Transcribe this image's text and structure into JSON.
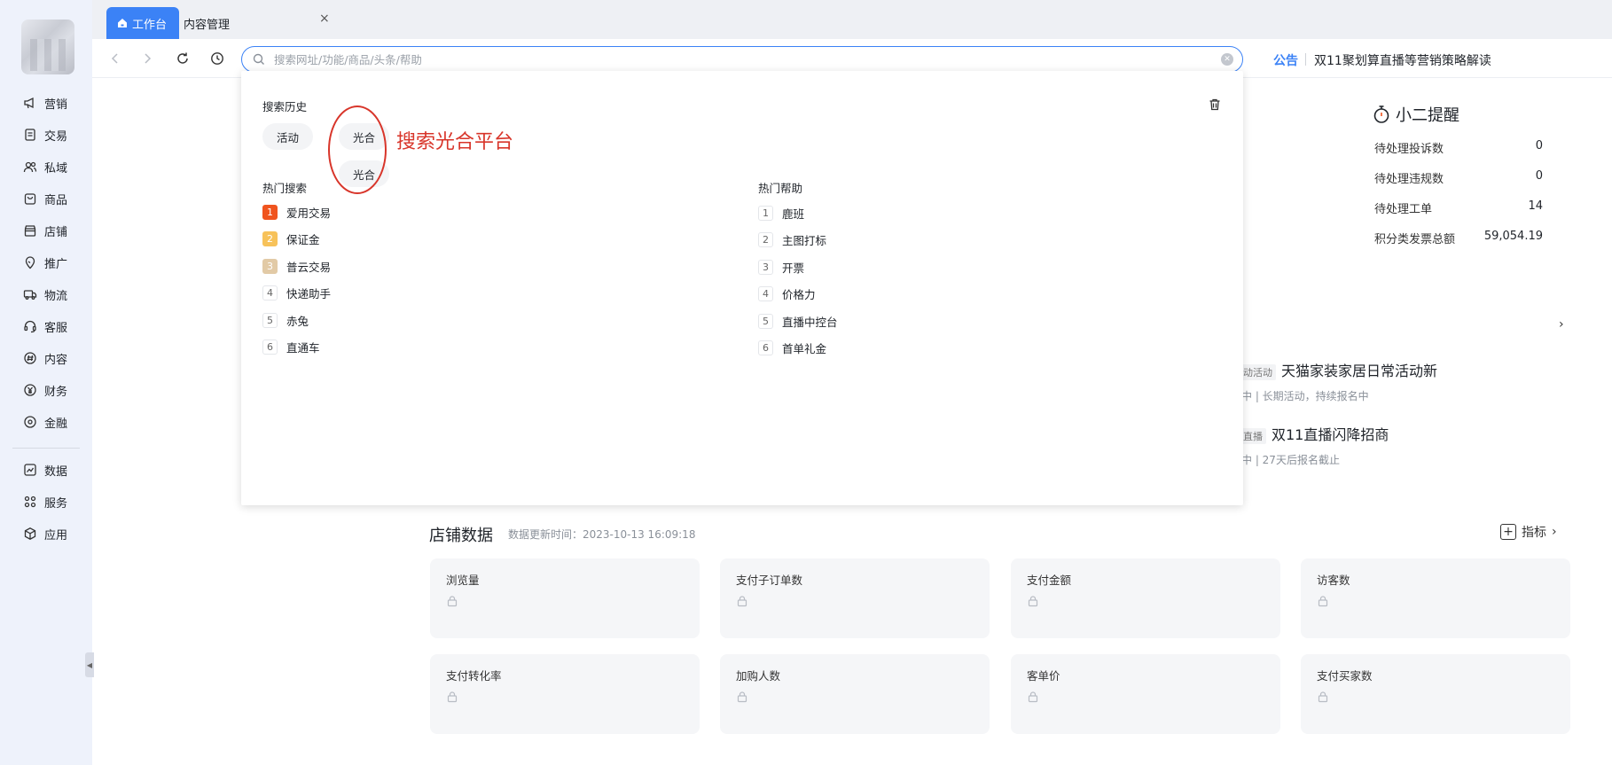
{
  "sidebar": {
    "items": [
      {
        "label": "营销",
        "icon": "megaphone-icon"
      },
      {
        "label": "交易",
        "icon": "document-icon"
      },
      {
        "label": "私域",
        "icon": "users-icon"
      },
      {
        "label": "商品",
        "icon": "shopping-bag-icon"
      },
      {
        "label": "店铺",
        "icon": "store-icon"
      },
      {
        "label": "推广",
        "icon": "location-pin-icon"
      },
      {
        "label": "物流",
        "icon": "truck-icon"
      },
      {
        "label": "客服",
        "icon": "headset-icon"
      },
      {
        "label": "内容",
        "icon": "hash-icon"
      },
      {
        "label": "财务",
        "icon": "yen-coin-icon"
      },
      {
        "label": "金融",
        "icon": "circle-target-icon"
      },
      {
        "label": "数据",
        "icon": "line-chart-icon"
      },
      {
        "label": "服务",
        "icon": "grid-icon"
      },
      {
        "label": "应用",
        "icon": "cube-icon"
      }
    ]
  },
  "tabs": {
    "home": "工作台",
    "content": "内容管理",
    "close": "×"
  },
  "toolbar": {
    "search_placeholder": "搜索网址/功能/商品/头条/帮助",
    "search_value": "",
    "notice_label": "公告",
    "notice_text": "双11聚划算直播等营销策略解读"
  },
  "dropdown": {
    "history_title": "搜索历史",
    "history": [
      "活动",
      "光合",
      "光合"
    ],
    "hot_search_title": "热门搜索",
    "hot_search": [
      {
        "rank": "1",
        "label": "爱用交易"
      },
      {
        "rank": "2",
        "label": "保证金"
      },
      {
        "rank": "3",
        "label": "普云交易"
      },
      {
        "rank": "4",
        "label": "快递助手"
      },
      {
        "rank": "5",
        "label": "赤兔"
      },
      {
        "rank": "6",
        "label": "直通车"
      }
    ],
    "hot_help_title": "热门帮助",
    "hot_help": [
      {
        "rank": "1",
        "label": "鹿班"
      },
      {
        "rank": "2",
        "label": "主图打标"
      },
      {
        "rank": "3",
        "label": "开票"
      },
      {
        "rank": "4",
        "label": "价格力"
      },
      {
        "rank": "5",
        "label": "直播中控台"
      },
      {
        "rank": "6",
        "label": "首单礼金"
      }
    ]
  },
  "annotation": {
    "text": "搜索光合平台",
    "color": "#d8352a"
  },
  "reminder": {
    "title": "小二提醒",
    "rows": [
      {
        "label": "待处理投诉数",
        "value": "0"
      },
      {
        "label": "待处理违规数",
        "value": "0"
      },
      {
        "label": "待处理工单",
        "value": "14"
      },
      {
        "label": "积分类发票总额",
        "value": "59,054.19"
      }
    ]
  },
  "activities": [
    {
      "tag": "动活动",
      "title": "天猫家装家居日常活动新",
      "sub": "中  |  长期活动，持续报名中"
    },
    {
      "tag": "直播",
      "title": "双11直播闪降招商",
      "sub": "中  |  27天后报名截止"
    }
  ],
  "store": {
    "title": "店铺数据",
    "update": "数据更新时间：2023-10-13 16:09:18",
    "metrics_link": "指标",
    "cards": [
      "浏览量",
      "支付子订单数",
      "支付金额",
      "访客数",
      "支付转化率",
      "加购人数",
      "客单价",
      "支付买家数"
    ]
  },
  "colors": {
    "accent": "#3b82f6",
    "sidebar_bg": "#eef2fb",
    "annotation": "#d8352a"
  }
}
